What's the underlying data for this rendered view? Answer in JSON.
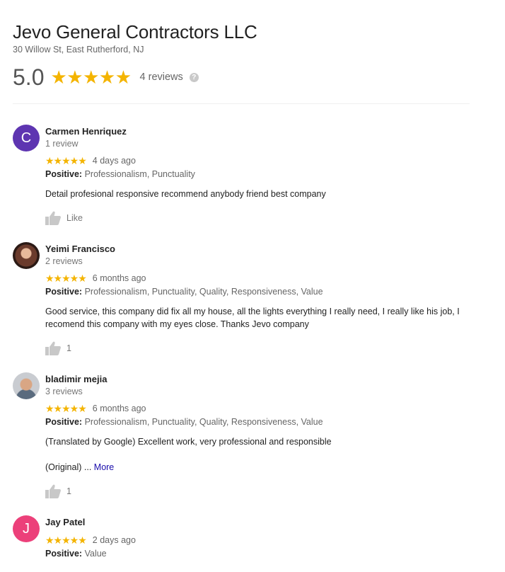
{
  "business": {
    "name": "Jevo General Contractors LLC",
    "address": "30 Willow St, East Rutherford, NJ",
    "rating": "5.0",
    "stars": "★★★★★",
    "review_count": "4 reviews",
    "help_glyph": "?"
  },
  "colors": {
    "star": "#f4b400",
    "link": "#1a0dab",
    "avatar_c": "#5e35b1",
    "avatar_j": "#ec407a"
  },
  "reviews": [
    {
      "name": "Carmen Henriquez",
      "meta": "1 review",
      "avatar_letter": "C",
      "stars": "★★★★★",
      "date": "4 days ago",
      "positive_label": "Positive:",
      "positive_values": "Professionalism, Punctuality",
      "text": "Detail profesional responsive recommend anybody friend best company",
      "like_label": "Like"
    },
    {
      "name": "Yeimi Francisco",
      "meta": "2 reviews",
      "stars": "★★★★★",
      "date": "6 months ago",
      "positive_label": "Positive:",
      "positive_values": "Professionalism, Punctuality, Quality, Responsiveness, Value",
      "text": "Good service, this company did fix all my house, all the lights everything I really need, I really like his job, I recomend this company with my eyes close. Thanks Jevo company",
      "like_label": "1"
    },
    {
      "name": "bladimir mejia",
      "meta": "3 reviews",
      "stars": "★★★★★",
      "date": "6 months ago",
      "positive_label": "Positive:",
      "positive_values": "Professionalism, Punctuality, Quality, Responsiveness, Value",
      "text": "(Translated by Google) Excellent work, very professional and responsible",
      "original_label": "(Original) ...",
      "more_label": "More",
      "like_label": "1"
    },
    {
      "name": "Jay Patel",
      "avatar_letter": "J",
      "stars": "★★★★★",
      "date": "2 days ago",
      "positive_label": "Positive:",
      "positive_values": "Value"
    }
  ]
}
